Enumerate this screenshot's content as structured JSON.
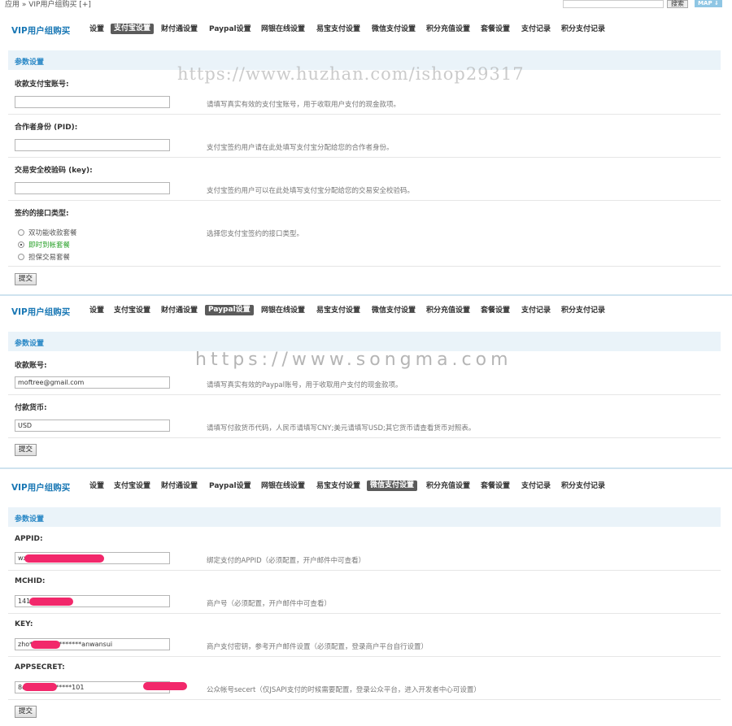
{
  "topbar": {
    "breadcrumb": "应用 » VIP用户组购买 [+]",
    "search_button": "搜索",
    "map_button": "MAP ⇓"
  },
  "menu": {
    "brand": "VIP用户组购买",
    "items": [
      "设置",
      "支付宝设置",
      "财付通设置",
      "Paypal设置",
      "网银在线设置",
      "易宝支付设置",
      "微信支付设置",
      "积分充值设置",
      "套餐设置",
      "支付记录",
      "积分支付记录"
    ]
  },
  "section_title": "参数设置",
  "submit_label": "提交",
  "alipay": {
    "active_tab": "支付宝设置",
    "fields": [
      {
        "label": "收款支付宝账号:",
        "value": "",
        "hint": "请填写真实有效的支付宝账号，用于收取用户支付的现金款项。"
      },
      {
        "label": "合作者身份 (PID):",
        "value": "",
        "hint": "支付宝签约用户请在此处填写支付宝分配给您的合作者身份。"
      },
      {
        "label": "交易安全校验码 (key):",
        "value": "",
        "hint": "支付宝签约用户可以在此处填写支付宝分配给您的交易安全校验码。"
      }
    ],
    "interface": {
      "label": "签约的接口类型:",
      "hint": "选择您支付宝签约的接口类型。",
      "options": [
        {
          "label": "双功能收款套餐",
          "checked": false
        },
        {
          "label": "即时到帐套餐",
          "checked": true
        },
        {
          "label": "担保交易套餐",
          "checked": false
        }
      ]
    }
  },
  "paypal": {
    "active_tab": "Paypal设置",
    "fields": [
      {
        "label": "收款账号:",
        "value": "moftree@gmail.com",
        "hint": "请填写真实有效的Paypal账号，用于收取用户支付的现金款项。"
      },
      {
        "label": "付款货币:",
        "value": "USD",
        "hint": "请填写付款货币代码，人民币请填写CNY;美元请填写USD;其它货币请查看货币对照表。"
      }
    ]
  },
  "wechat": {
    "active_tab": "微信支付设置",
    "fields": [
      {
        "label": "APPID:",
        "value": "wx",
        "hint": "绑定支付的APPID（必须配置，开户邮件中可查看）"
      },
      {
        "label": "MCHID:",
        "value": "141",
        "hint": "商户号（必须配置，开户邮件中可查看）"
      },
      {
        "label": "KEY:",
        "value": "zho****************anwansui",
        "hint": "商户支付密钥，参考开户邮件设置（必须配置，登录商户平台自行设置）"
      },
      {
        "label": "APPSECRET:",
        "value": "8d**************101",
        "hint": "公众帐号secert（仅JSAPI支付的时候需要配置，登录公众平台，进入开发者中心可设置）"
      }
    ]
  },
  "watermarks": [
    "https://www.huzhan.com/ishop29317",
    "https://www.songma.com"
  ],
  "colors": {
    "accent": "#1a78b5",
    "section_bg": "#eaf3f9",
    "active_tab_bg": "#5b5b5b",
    "redaction": "#f2286b"
  }
}
